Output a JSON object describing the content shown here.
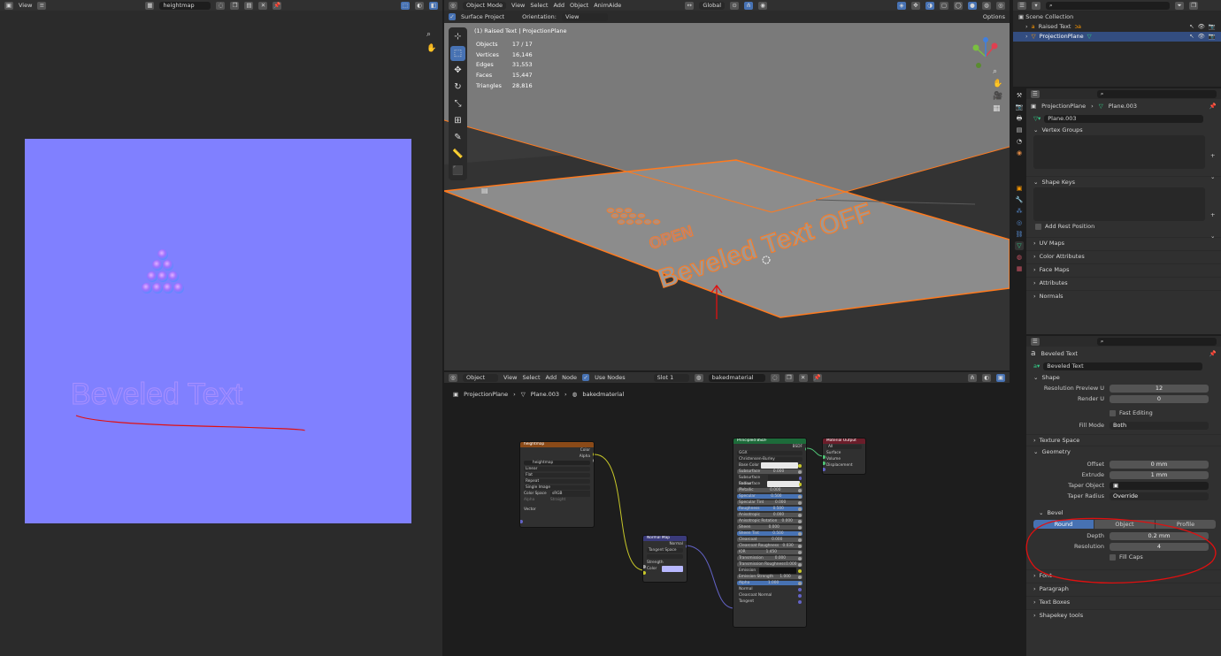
{
  "image_editor": {
    "view_menu": "View",
    "image_name": "heightmap",
    "raised_text": "Beveled Text"
  },
  "viewport": {
    "mode": "Object Mode",
    "menus": [
      "View",
      "Select",
      "Add",
      "Object",
      "AnimAide"
    ],
    "orientation_global": "Global",
    "surface_project_label": "Surface Project",
    "orientation_label": "Orientation:",
    "orientation_value": "View",
    "options_label": "Options",
    "object_title": "(1) Raised Text | ProjectionPlane",
    "stats": [
      {
        "label": "Objects",
        "value": "17 / 17"
      },
      {
        "label": "Vertices",
        "value": "16,146"
      },
      {
        "label": "Edges",
        "value": "31,553"
      },
      {
        "label": "Faces",
        "value": "15,447"
      },
      {
        "label": "Triangles",
        "value": "28,816"
      }
    ],
    "scene_text_open": "OPEN",
    "scene_text_main": "Beveled Text OFF"
  },
  "node_editor": {
    "object_mode": "Object",
    "menus": [
      "View",
      "Select",
      "Add",
      "Node"
    ],
    "use_nodes_label": "Use Nodes",
    "slot": "Slot 1",
    "material": "bakedmaterial",
    "breadcrumb": [
      "ProjectionPlane",
      "Plane.003",
      "bakedmaterial"
    ],
    "image_node": {
      "title": "heightmap",
      "out_color": "Color",
      "out_alpha": "Alpha",
      "image": "heightmap",
      "rows": [
        "Linear",
        "Flat",
        "Repeat",
        "Single Image"
      ],
      "colorspace_label": "Color Space",
      "colorspace_value": "sRGB",
      "alpha_label": "Alpha",
      "alpha_value": "Straight",
      "vector": "Vector"
    },
    "normal_node": {
      "title": "Normal Map",
      "out_normal": "Normal",
      "space": "Tangent Space",
      "strength": "Strength",
      "color": "Color"
    },
    "bsdf_node": {
      "title": "Principled BSDF",
      "out": "BSDF",
      "dist": "GGX",
      "sss": "Christensen-Burley",
      "rows": [
        {
          "label": "Base Color",
          "value": "",
          "kind": "color"
        },
        {
          "label": "Subsurface",
          "value": "0.000",
          "kind": "slider"
        },
        {
          "label": "Subsurface Radius",
          "value": "",
          "kind": "dd"
        },
        {
          "label": "Subsurface Color",
          "value": "",
          "kind": "color"
        },
        {
          "label": "Metallic",
          "value": "0.000",
          "kind": "slider"
        },
        {
          "label": "Specular",
          "value": "0.500",
          "kind": "blue"
        },
        {
          "label": "Specular Tint",
          "value": "0.000",
          "kind": "slider"
        },
        {
          "label": "Roughness",
          "value": "0.500",
          "kind": "blue"
        },
        {
          "label": "Anisotropic",
          "value": "0.000",
          "kind": "slider"
        },
        {
          "label": "Anisotropic Rotation",
          "value": "0.000",
          "kind": "slider"
        },
        {
          "label": "Sheen",
          "value": "0.000",
          "kind": "slider"
        },
        {
          "label": "Sheen Tint",
          "value": "0.500",
          "kind": "blue"
        },
        {
          "label": "Clearcoat",
          "value": "0.000",
          "kind": "slider"
        },
        {
          "label": "Clearcoat Roughness",
          "value": "0.030",
          "kind": "slider"
        },
        {
          "label": "IOR",
          "value": "1.450",
          "kind": "slider"
        },
        {
          "label": "Transmission",
          "value": "0.000",
          "kind": "slider"
        },
        {
          "label": "Transmission Roughness",
          "value": "0.000",
          "kind": "slider"
        },
        {
          "label": "Emission",
          "value": "",
          "kind": "dark"
        },
        {
          "label": "Emission Strength",
          "value": "1.000",
          "kind": "slider"
        },
        {
          "label": "Alpha",
          "value": "1.000",
          "kind": "blue"
        },
        {
          "label": "Normal",
          "value": "",
          "kind": "plain"
        },
        {
          "label": "Clearcoat Normal",
          "value": "",
          "kind": "plain"
        },
        {
          "label": "Tangent",
          "value": "",
          "kind": "plain"
        }
      ]
    },
    "output_node": {
      "title": "Material Output",
      "target": "All",
      "surface": "Surface",
      "volume": "Volume",
      "displacement": "Displacement"
    }
  },
  "outliner": {
    "root": "Scene Collection",
    "items": [
      "Raised Text",
      "ProjectionPlane"
    ]
  },
  "mesh_props": {
    "breadcrumb_obj": "ProjectionPlane",
    "breadcrumb_data": "Plane.003",
    "mesh_name": "Plane.003",
    "vertex_groups": "Vertex Groups",
    "shape_keys": "Shape Keys",
    "add_rest": "Add Rest Position",
    "panels": [
      "UV Maps",
      "Color Attributes",
      "Face Maps",
      "Attributes",
      "Normals"
    ]
  },
  "curve_props": {
    "breadcrumb": "Beveled Text",
    "data_name": "Beveled Text",
    "shape": "Shape",
    "res_u_label": "Resolution Preview U",
    "res_u": "12",
    "render_u_label": "Render U",
    "render_u": "0",
    "fast_editing": "Fast Editing",
    "fill_mode_label": "Fill Mode",
    "fill_mode": "Both",
    "texture_space": "Texture Space",
    "geometry": "Geometry",
    "offset_label": "Offset",
    "offset": "0 mm",
    "extrude_label": "Extrude",
    "extrude": "1 mm",
    "taper_obj_label": "Taper Object",
    "taper_radius_label": "Taper Radius",
    "taper_radius": "Override",
    "bevel": "Bevel",
    "bevel_modes": [
      "Round",
      "Object",
      "Profile"
    ],
    "depth_label": "Depth",
    "depth": "0.2 mm",
    "resolution_label": "Resolution",
    "resolution": "4",
    "fill_caps": "Fill Caps",
    "panels": [
      "Font",
      "Paragraph",
      "Text Boxes",
      "Shapekey tools"
    ]
  },
  "colors": {
    "accent": "#4772b3",
    "selection_orange": "#ff7a1e",
    "normal_map_bg": "#8080ff",
    "annotation_red": "#e01010"
  }
}
